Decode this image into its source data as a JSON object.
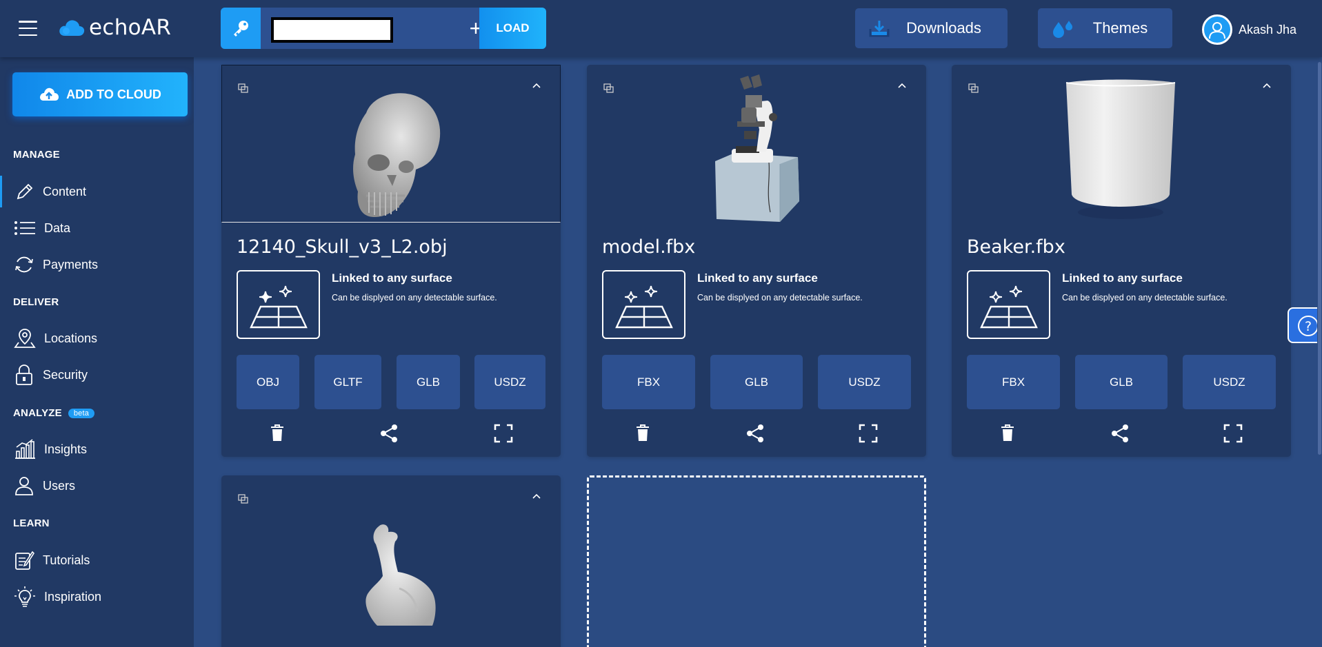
{
  "header": {
    "logo_text": "echoAR",
    "api_key_value": "",
    "plus_label": "+",
    "load_label": "LOAD",
    "downloads_label": "Downloads",
    "themes_label": "Themes",
    "user_name": "Akash Jha"
  },
  "sidebar": {
    "add_to_cloud_label": "ADD TO CLOUD",
    "sections": {
      "manage": "MANAGE",
      "deliver": "DELIVER",
      "analyze": "ANALYZE",
      "analyze_badge": "beta",
      "learn": "LEARN"
    },
    "items": [
      {
        "label": "Content",
        "icon": "pencil-icon",
        "active": true
      },
      {
        "label": "Data",
        "icon": "list-icon"
      },
      {
        "label": "Payments",
        "icon": "refresh-icon"
      },
      {
        "label": "Locations",
        "icon": "map-pin-icon"
      },
      {
        "label": "Security",
        "icon": "lock-icon"
      },
      {
        "label": "Insights",
        "icon": "bar-chart-icon"
      },
      {
        "label": "Users",
        "icon": "user-icon"
      },
      {
        "label": "Tutorials",
        "icon": "edit-note-icon"
      },
      {
        "label": "Inspiration",
        "icon": "lightbulb-icon"
      }
    ]
  },
  "cards": [
    {
      "title": "12140_Skull_v3_L2.obj",
      "surface_title": "Linked to any surface",
      "surface_subtitle": "Can be displyed on any detectable surface.",
      "formats": [
        "OBJ",
        "GLTF",
        "GLB",
        "USDZ"
      ]
    },
    {
      "title": "model.fbx",
      "surface_title": "Linked to any surface",
      "surface_subtitle": "Can be displyed on any detectable surface.",
      "formats": [
        "FBX",
        "GLB",
        "USDZ"
      ]
    },
    {
      "title": "Beaker.fbx",
      "surface_title": "Linked to any surface",
      "surface_subtitle": "Can be displyed on any detectable surface.",
      "formats": [
        "FBX",
        "GLB",
        "USDZ"
      ]
    }
  ],
  "help_label": "?",
  "colors": {
    "page_bg": "#2b4b82",
    "panel_bg": "#213964",
    "button_bg": "#2d5090",
    "accent": "#1e9cf4"
  }
}
